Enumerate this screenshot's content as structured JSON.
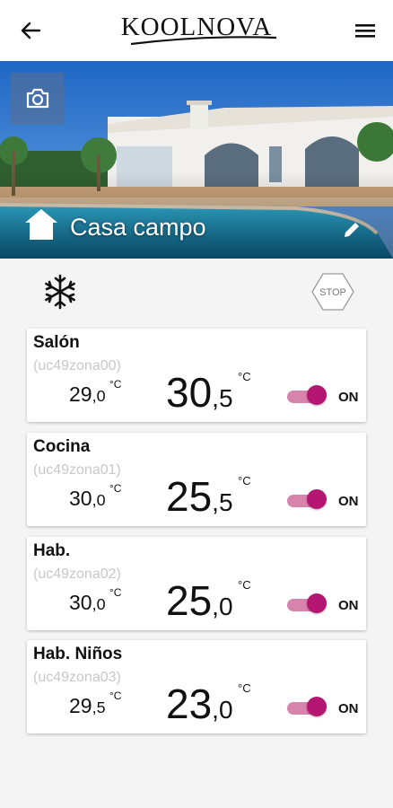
{
  "header": {
    "brand": "KOOLNOVA",
    "back_icon": "arrow-left-icon",
    "menu_icon": "hamburger-menu-icon"
  },
  "hero": {
    "title": "Casa campo",
    "camera_icon": "camera-icon",
    "home_icon": "home-icon",
    "edit_icon": "pencil-icon"
  },
  "controls": {
    "mode_icon": "snowflake-icon",
    "stop_label": "STOP"
  },
  "zones": [
    {
      "name": "Salón",
      "id": "(uc49zona00)",
      "current_int": "29",
      "current_dec": ",0",
      "current_unit": "°C",
      "set_int": "30",
      "set_dec": ",5",
      "set_unit": "°C",
      "on": true,
      "status": "ON"
    },
    {
      "name": "Cocina",
      "id": "(uc49zona01)",
      "current_int": "30",
      "current_dec": ",0",
      "current_unit": "°C",
      "set_int": "25",
      "set_dec": ",5",
      "set_unit": "°C",
      "on": true,
      "status": "ON"
    },
    {
      "name": "Hab.",
      "id": "(uc49zona02)",
      "current_int": "30",
      "current_dec": ",0",
      "current_unit": "°C",
      "set_int": "25",
      "set_dec": ",0",
      "set_unit": "°C",
      "on": true,
      "status": "ON"
    },
    {
      "name": "Hab. Niños",
      "id": "(uc49zona03)",
      "current_int": "29",
      "current_dec": ",5",
      "current_unit": "°C",
      "set_int": "23",
      "set_dec": ",0",
      "set_unit": "°C",
      "on": true,
      "status": "ON"
    }
  ],
  "colors": {
    "accent": "#b51671",
    "track": "#d784ad",
    "zone_id": "#c8c8c8"
  }
}
